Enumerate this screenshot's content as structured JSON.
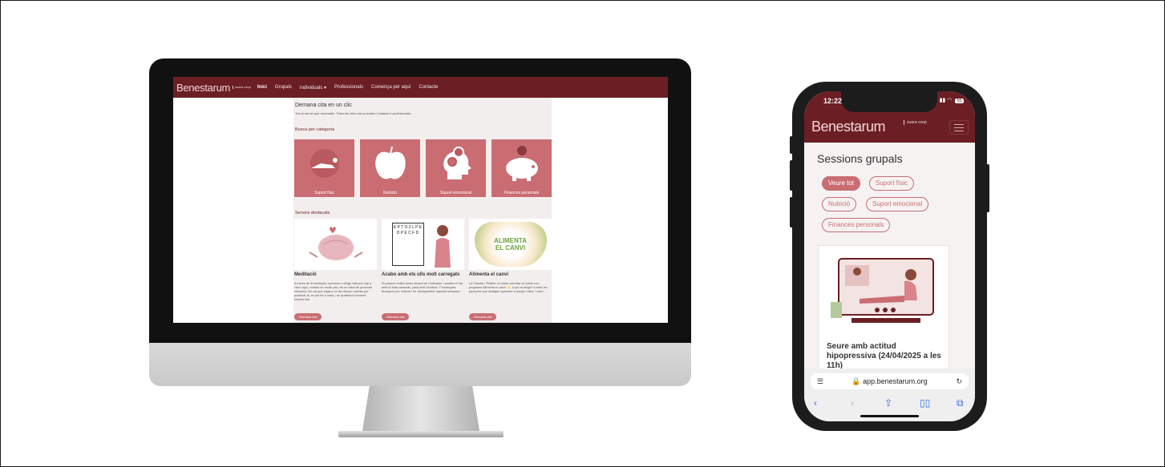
{
  "desktop": {
    "logo": "Benestarum",
    "logo_sub": "suara coop",
    "nav": [
      "Inici",
      "Grupals",
      "Individuals ▾",
      "Professionals",
      "Comença per aquí",
      "Contacte"
    ],
    "heading": "Demana cita en un clic",
    "subheading": "Tria el servei que necessitis. Totes les cites són privades i totalment confidencials.",
    "category_heading": "Busca per categoria",
    "categories": [
      "Suport físic",
      "Nutrició",
      "Suport emocional",
      "Finances personals"
    ],
    "featured_heading": "Serveis destacats",
    "services": [
      {
        "title": "Meditació",
        "text": "A través de la meditació, aprenem a dirigir l'atenció cap a l'ara i aquí, entrant en mode pau; fer un estat de profunda relaxació. No cal que vagis a un lloc llunyà i sabràs per practicar-la, es pot fer a casa, i en qualsevol moment. Només has",
        "button": "Demana cita",
        "image_text": ""
      },
      {
        "title": "Acabo amb els ulls molt carregats",
        "text": "Si passes moltes hores davant de l'ordinador i acabes el dia amb la vista cansada, parla amb l'Andrea. T'ensenyarà tècniques per millorar i fer desaparèixer aquesta sensació.",
        "button": "Demana cita",
        "image_text": "E P T O Z L P E D P E C F D"
      },
      {
        "title": "Alimenta el canvi",
        "text": "La Clàudia i l'Esther et volem convidar al nostre nou programa Alimenta el canvi. ⭐ A qui va dirigit? A totes les persones que desitgen aprendre a menjar millor i volen",
        "button": "Demana cita",
        "image_text": "ALIMENTA EL CANVI"
      }
    ]
  },
  "mobile": {
    "time": "12:22",
    "battery": "65",
    "logo": "Benestarum",
    "logo_sub": "suara coop",
    "title": "Sessions grupals",
    "chips": [
      "Veure tot",
      "Suport físic",
      "Nutrició",
      "Suport emocional",
      "Finances personals"
    ],
    "card_title": "Seure amb actitud hipopressiva (24/04/2025 a les 11h)",
    "url": "🔒 app.benestarum.org"
  },
  "colors": {
    "brand": "#6b1f24",
    "accent": "#c96d73"
  }
}
